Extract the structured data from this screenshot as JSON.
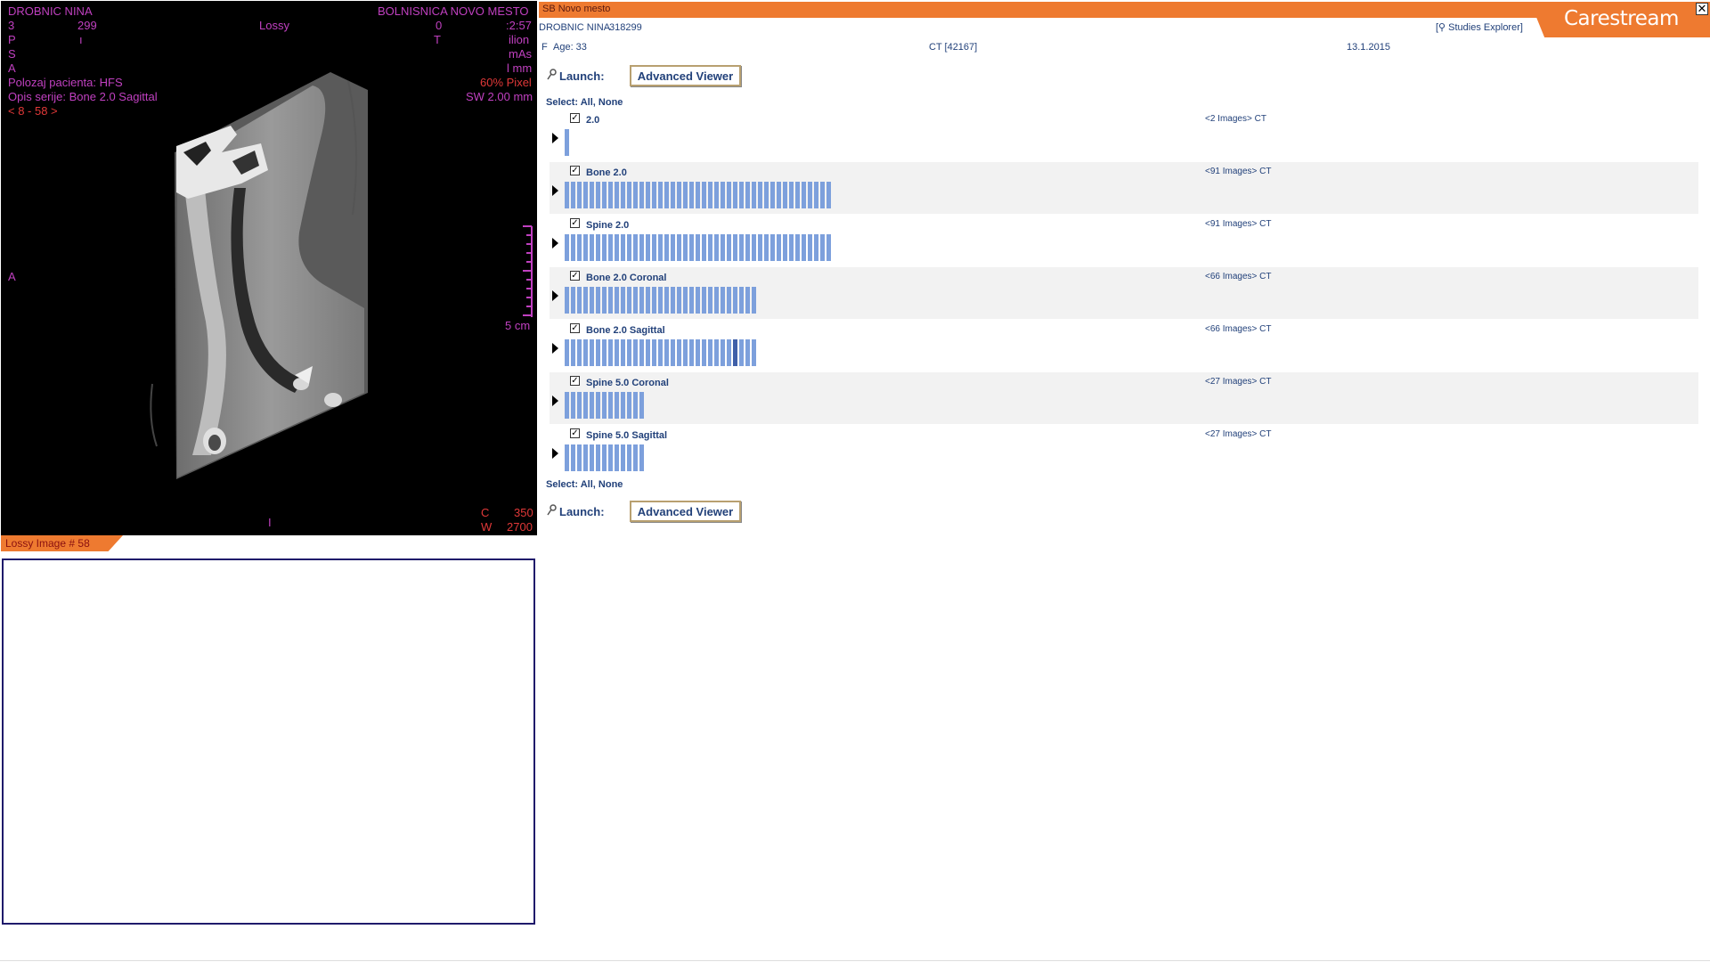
{
  "viewer": {
    "patient_name": "DROBNIC NINA",
    "institution": "BOLNISNICA NOVO MESTO",
    "line2_left": "3",
    "line2_num": "299",
    "compression": "Lossy",
    "line2_mid": "0",
    "line2_right": ":2:57",
    "line3_left": "P",
    "line3_mid": "ı",
    "line3_right": "T",
    "line3_far": "ilion",
    "line4_left": "S",
    "line4_right": "mAs",
    "line5_left": "A",
    "line5_right": "l mm",
    "patient_position": "Polozaj pacienta: HFS",
    "zoom": "60% Pixel",
    "series_desc": "Opis serije: Bone 2.0 Sagittal",
    "slice_width": "SW 2.00 mm",
    "image_range": "< 8 - 58 >",
    "orientation_left": "A",
    "orientation_bottom": "I",
    "scale_label": "5 cm",
    "window_center_label": "C",
    "window_center": "350",
    "window_width_label": "W",
    "window_width": "2700"
  },
  "lossy_tab": {
    "label": "Lossy Image #",
    "number": "58"
  },
  "header": {
    "hospital": "SB Novo mesto",
    "close": "✕",
    "logo": "Carestream",
    "patient_name": "DROBNIC NINA",
    "patient_id": "318299",
    "sex": "F",
    "age": "Age: 33",
    "modality": "CT [42167]",
    "date": "13.1.2015",
    "studies_explorer": "[⚲ Studies Explorer]"
  },
  "launch": {
    "label": "Launch:",
    "button": "Advanced Viewer"
  },
  "select": {
    "label": "Select:",
    "all": "All",
    "sep": ",",
    "none": "None"
  },
  "series": [
    {
      "name": "2.0",
      "count": "<2 Images> CT",
      "thumbs": 1,
      "checked": "✓"
    },
    {
      "name": "Bone 2.0",
      "count": "<91 Images> CT",
      "thumbs": 43,
      "checked": "✓"
    },
    {
      "name": "Spine 2.0",
      "count": "<91 Images> CT",
      "thumbs": 43,
      "checked": "✓"
    },
    {
      "name": "Bone 2.0 Coronal",
      "count": "<66 Images> CT",
      "thumbs": 31,
      "checked": "✓"
    },
    {
      "name": "Bone 2.0 Sagittal",
      "count": "<66 Images> CT",
      "thumbs": 31,
      "selected_thumb": 27,
      "checked": "✓"
    },
    {
      "name": "Spine 5.0 Coronal",
      "count": "<27 Images> CT",
      "thumbs": 13,
      "checked": "✓"
    },
    {
      "name": "Spine 5.0 Sagittal",
      "count": "<27 Images> CT",
      "thumbs": 13,
      "checked": "✓"
    }
  ]
}
